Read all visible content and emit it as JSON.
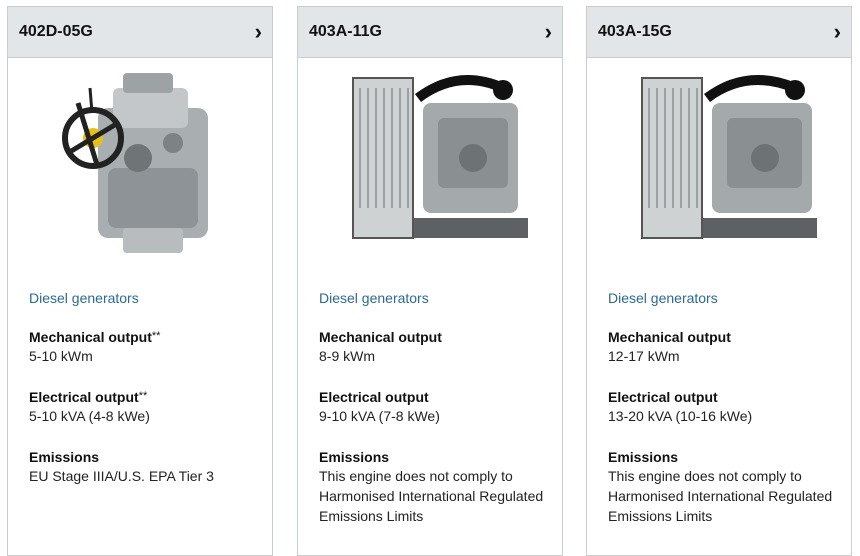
{
  "products": [
    {
      "model": "402D-05G",
      "category": "Diesel generators",
      "mechanical_label": "Mechanical output",
      "mechanical_note": "**",
      "mechanical_value": "5-10 kWm",
      "electrical_label": "Electrical output",
      "electrical_note": "**",
      "electrical_value": "5-10 kVA (4-8 kWe)",
      "emissions_label": "Emissions",
      "emissions_value": "EU Stage IIIA/U.S. EPA Tier 3"
    },
    {
      "model": "403A-11G",
      "category": "Diesel generators",
      "mechanical_label": "Mechanical output",
      "mechanical_value": "8-9 kWm",
      "electrical_label": "Electrical output",
      "electrical_value": "9-10 kVA (7-8 kWe)",
      "emissions_label": "Emissions",
      "emissions_value": "This engine does not comply to Harmonised International Regulated Emissions Limits"
    },
    {
      "model": "403A-15G",
      "category": "Diesel generators",
      "mechanical_label": "Mechanical output",
      "mechanical_value": "12-17 kWm",
      "electrical_label": "Electrical output",
      "electrical_value": "13-20 kVA (10-16 kWe)",
      "emissions_label": "Emissions",
      "emissions_value": "This engine does not comply to Harmonised International Regulated Emissions Limits"
    }
  ],
  "icons": {
    "chevron": "chevron-right-icon"
  },
  "chevron_glyph": "›"
}
